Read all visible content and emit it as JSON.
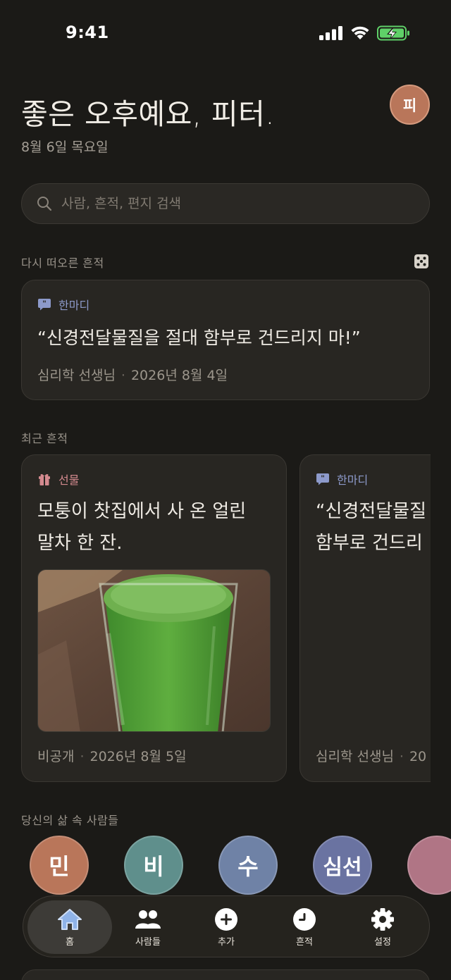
{
  "status_bar": {
    "time": "9:41"
  },
  "header": {
    "greeting": "좋은 오후예요, 피터.",
    "date": "8월 6일 목요일",
    "avatar_initial": "피"
  },
  "search": {
    "placeholder": "사람, 흔적, 편지 검색"
  },
  "resurfaced": {
    "section_title": "다시 떠오른 흔적",
    "card": {
      "tag": "한마디",
      "quote": "“신경전달물질을 절대 함부로 건드리지 마!”",
      "author": "심리학 선생님",
      "date": "2026년 8월 4일"
    }
  },
  "recent": {
    "section_title": "최근 흔적",
    "cards": [
      {
        "tag": "선물",
        "text_line1": "모퉁이 찻집에서 사 온 얼린",
        "text_line2": "말차 한 잔.",
        "author": "비공개",
        "date": "2026년 8월 5일"
      },
      {
        "tag": "한마디",
        "text_line1": "“신경전달물질",
        "text_line2": "함부로 건드리",
        "author": "심리학 선생님",
        "date": "20"
      }
    ]
  },
  "people": {
    "section_title": "당신의 삶 속 사람들",
    "items": [
      {
        "initial": "민",
        "color": "#b9765a"
      },
      {
        "initial": "비",
        "color": "#5f8f8c"
      },
      {
        "initial": "수",
        "color": "#6f82a6"
      },
      {
        "initial": "심선",
        "color": "#6a73a1"
      },
      {
        "initial": "",
        "color": "#b07585"
      }
    ]
  },
  "tabbar": {
    "items": [
      {
        "label": "홈"
      },
      {
        "label": "사람들"
      },
      {
        "label": "추가"
      },
      {
        "label": "흔적"
      },
      {
        "label": "설정"
      }
    ]
  },
  "colors": {
    "background": "#1b1a17",
    "card": "#282622",
    "saying_accent": "#8d9acb",
    "gift_accent": "#d48a8f"
  }
}
